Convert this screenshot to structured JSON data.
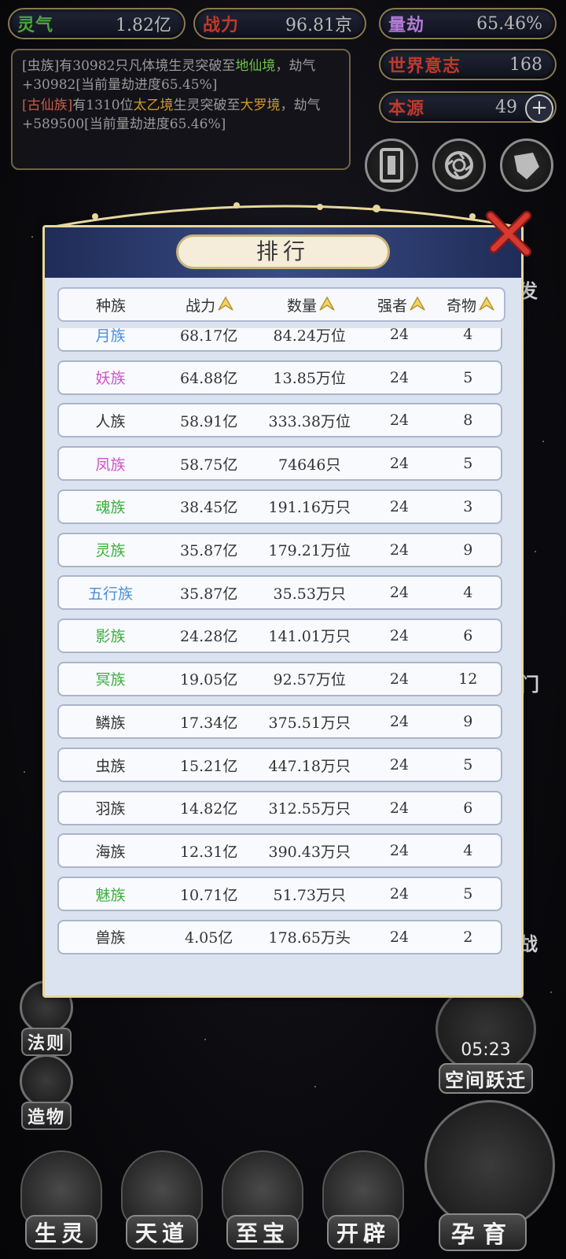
{
  "resources": {
    "lingqi": {
      "label": "灵气",
      "value": "1.82亿",
      "color": "#4aa63a"
    },
    "zhanli": {
      "label": "战力",
      "value": "96.81京",
      "color": "#c0392b"
    },
    "liangjie": {
      "label": "量劫",
      "value": "65.46%",
      "color": "#b37bd8"
    },
    "shijie": {
      "label": "世界意志",
      "value": "168",
      "color": "#c0392b"
    },
    "benyuan": {
      "label": "本源",
      "value": "49",
      "color": "#c0392b",
      "plus": "+"
    }
  },
  "log": [
    {
      "parts": [
        {
          "t": "[虫族]有30982只凡体境生灵突破至",
          "c": ""
        },
        {
          "t": "地仙境",
          "c": "c-green"
        },
        {
          "t": "，劫气+30982[当前量劫进度65.45%]",
          "c": ""
        }
      ]
    },
    {
      "parts": [
        {
          "t": "[古仙族]",
          "c": "c-red"
        },
        {
          "t": "有1310位",
          "c": ""
        },
        {
          "t": "太乙境",
          "c": "c-orange"
        },
        {
          "t": "生灵突破至",
          "c": ""
        },
        {
          "t": "大罗境",
          "c": "c-orange"
        },
        {
          "t": "，劫气+589500[当前量劫进度65.46%]",
          "c": ""
        }
      ]
    }
  ],
  "peek": {
    "fa": "发",
    "men": "门",
    "zhan": "战"
  },
  "side_menu": [
    {
      "label": "法则"
    },
    {
      "label": "造物"
    }
  ],
  "bottom_nav": [
    {
      "label": "生灵"
    },
    {
      "label": "天道"
    },
    {
      "label": "至宝"
    },
    {
      "label": "开辟"
    }
  ],
  "space_jump": {
    "timer": "05:23",
    "label": "空间跃迁"
  },
  "breed": {
    "label": "孕育"
  },
  "ranking": {
    "title": "排行",
    "columns": [
      "种族",
      "战力",
      "数量",
      "强者",
      "奇物"
    ],
    "rows": [
      {
        "race": "月族",
        "race_color": "#4a8fd8",
        "power": "68.17亿",
        "count": "84.24万位",
        "strong": "24",
        "treasure": "4"
      },
      {
        "race": "妖族",
        "race_color": "#d54fc9",
        "power": "64.88亿",
        "count": "13.85万位",
        "strong": "24",
        "treasure": "5"
      },
      {
        "race": "人族",
        "race_color": "#333333",
        "power": "58.91亿",
        "count": "333.38万位",
        "strong": "24",
        "treasure": "8"
      },
      {
        "race": "凤族",
        "race_color": "#d54fc9",
        "power": "58.75亿",
        "count": "74646只",
        "strong": "24",
        "treasure": "5"
      },
      {
        "race": "魂族",
        "race_color": "#3aaf3a",
        "power": "38.45亿",
        "count": "191.16万只",
        "strong": "24",
        "treasure": "3"
      },
      {
        "race": "灵族",
        "race_color": "#3aaf3a",
        "power": "35.87亿",
        "count": "179.21万位",
        "strong": "24",
        "treasure": "9"
      },
      {
        "race": "五行族",
        "race_color": "#4a8fd8",
        "power": "35.87亿",
        "count": "35.53万只",
        "strong": "24",
        "treasure": "4"
      },
      {
        "race": "影族",
        "race_color": "#3aaf3a",
        "power": "24.28亿",
        "count": "141.01万只",
        "strong": "24",
        "treasure": "6"
      },
      {
        "race": "冥族",
        "race_color": "#3aaf3a",
        "power": "19.05亿",
        "count": "92.57万位",
        "strong": "24",
        "treasure": "12"
      },
      {
        "race": "鳞族",
        "race_color": "#333333",
        "power": "17.34亿",
        "count": "375.51万只",
        "strong": "24",
        "treasure": "9"
      },
      {
        "race": "虫族",
        "race_color": "#333333",
        "power": "15.21亿",
        "count": "447.18万只",
        "strong": "24",
        "treasure": "5"
      },
      {
        "race": "羽族",
        "race_color": "#333333",
        "power": "14.82亿",
        "count": "312.55万只",
        "strong": "24",
        "treasure": "6"
      },
      {
        "race": "海族",
        "race_color": "#333333",
        "power": "12.31亿",
        "count": "390.43万只",
        "strong": "24",
        "treasure": "4"
      },
      {
        "race": "魅族",
        "race_color": "#3aaf3a",
        "power": "10.71亿",
        "count": "51.73万只",
        "strong": "24",
        "treasure": "5"
      },
      {
        "race": "兽族",
        "race_color": "#333333",
        "power": "4.05亿",
        "count": "178.65万头",
        "strong": "24",
        "treasure": "2"
      }
    ]
  }
}
